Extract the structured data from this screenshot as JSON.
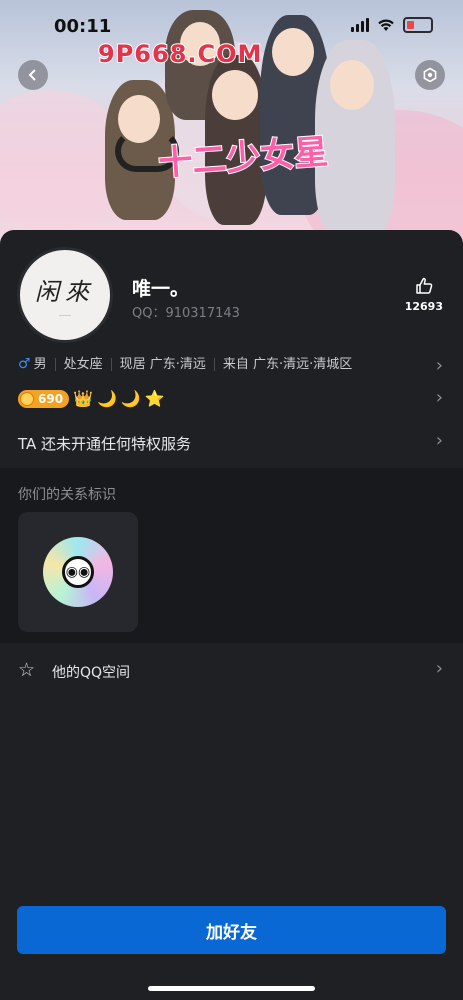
{
  "status_bar": {
    "time": "00:11"
  },
  "banner": {
    "watermark": "9P668.COM",
    "logo_text": "十二少女星"
  },
  "profile": {
    "avatar_text": "闲來",
    "avatar_subtext": "……",
    "nickname": "唯一。",
    "qq_label": "QQ：910317143",
    "likes": "12693"
  },
  "info": {
    "gender_symbol": "♂",
    "gender": "男",
    "zodiac": "处女座",
    "location": "现居 广东·清远",
    "hometown": "来自 广东·清远·清城区"
  },
  "level": {
    "coins": "690",
    "icons": [
      "👑",
      "🌙",
      "🌙",
      "⭐"
    ]
  },
  "privilege_text": "TA 还未开通任何特权服务",
  "relationship": {
    "title": "你们的关系标识"
  },
  "qzone": {
    "label": "他的QQ空间"
  },
  "actions": {
    "add_friend": "加好友"
  },
  "colors": {
    "accent": "#0a68d4",
    "background": "#1f2024",
    "coin": "#f4a224"
  }
}
